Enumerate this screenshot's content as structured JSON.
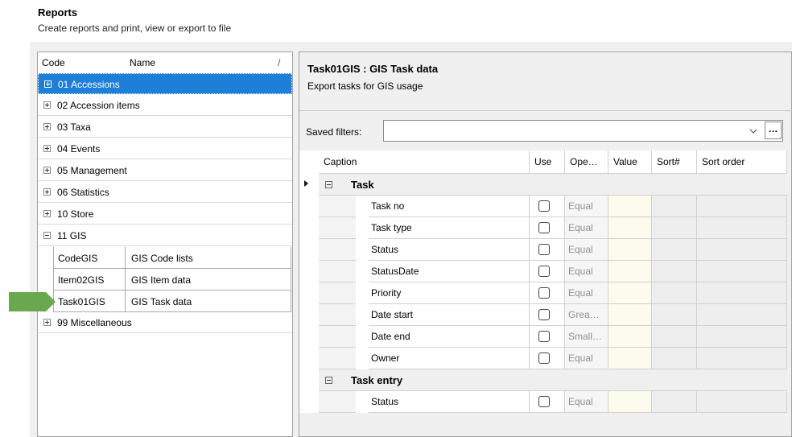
{
  "header": {
    "title": "Reports",
    "subtitle": "Create reports and print, view or export to file"
  },
  "tree": {
    "col_code": "Code",
    "col_name": "Name",
    "sort_marker": "/",
    "nodes": [
      {
        "label": "01 Accessions",
        "expanded": false,
        "selected": true
      },
      {
        "label": "02 Accession items",
        "expanded": false
      },
      {
        "label": "03 Taxa",
        "expanded": false
      },
      {
        "label": "04 Events",
        "expanded": false
      },
      {
        "label": "05 Management",
        "expanded": false
      },
      {
        "label": "06 Statistics",
        "expanded": false
      },
      {
        "label": "10 Store",
        "expanded": false
      },
      {
        "label": "11 GIS",
        "expanded": true
      },
      {
        "label": "99 Miscellaneous",
        "expanded": false
      }
    ],
    "children": [
      {
        "code": "CodeGIS",
        "name": "GIS Code lists"
      },
      {
        "code": "Item02GIS",
        "name": "GIS Item data"
      },
      {
        "code": "Task01GIS",
        "name": "GIS Task data"
      }
    ]
  },
  "detail": {
    "title": "Task01GIS : GIS Task data",
    "description": "Export tasks for GIS usage",
    "saved_filters_label": "Saved filters:",
    "saved_filters_value": "",
    "more_button": "…"
  },
  "grid": {
    "columns": [
      "Caption",
      "Use",
      "Ope…",
      "Value",
      "Sort#",
      "Sort order"
    ],
    "groups": [
      {
        "name": "Task",
        "rows": [
          {
            "caption": "Task no",
            "op": "Equal"
          },
          {
            "caption": "Task type",
            "op": "Equal"
          },
          {
            "caption": "Status",
            "op": "Equal"
          },
          {
            "caption": "StatusDate",
            "op": "Equal"
          },
          {
            "caption": "Priority",
            "op": "Equal"
          },
          {
            "caption": "Date start",
            "op": "Grea…"
          },
          {
            "caption": "Date end",
            "op": "Small…"
          },
          {
            "caption": "Owner",
            "op": "Equal"
          }
        ]
      },
      {
        "name": "Task entry",
        "rows": [
          {
            "caption": "Status",
            "op": "Equal"
          }
        ]
      }
    ]
  },
  "colors": {
    "selection": "#1e7fd8",
    "arrow": "#6aa84f",
    "value_cell": "#fbfbee"
  }
}
